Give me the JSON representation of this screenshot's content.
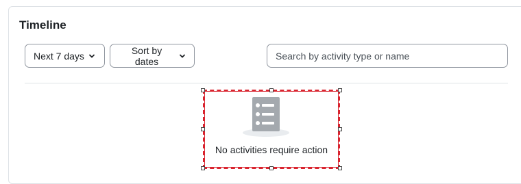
{
  "block": {
    "title": "Timeline"
  },
  "filters": {
    "days_label": "Next 7 days",
    "sort_label": "Sort by dates"
  },
  "search": {
    "placeholder": "Search by activity type or name",
    "value": ""
  },
  "empty_state": {
    "message": "No activities require action",
    "icon": "activity-list-icon"
  },
  "colors": {
    "selection_outline": "#d9232e",
    "border": "#8f959e",
    "divider": "#dee2e6"
  }
}
